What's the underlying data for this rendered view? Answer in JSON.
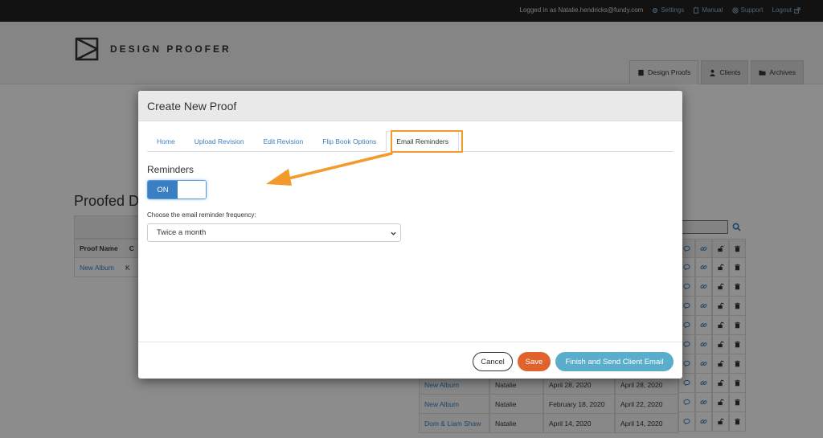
{
  "topbar": {
    "login_text": "Logged in as Natalie.hendricks@fundy.com",
    "links": [
      {
        "label": "Settings",
        "icon": "gear-icon"
      },
      {
        "label": "Manual",
        "icon": "book-icon"
      },
      {
        "label": "Support",
        "icon": "lifebuoy-icon"
      },
      {
        "label": "Logout",
        "icon": "external-link-icon"
      }
    ]
  },
  "header": {
    "logo_text": "DESIGN PROOFER",
    "nav_tabs": [
      {
        "label": "Design Proofs",
        "icon": "book-icon",
        "active": true
      },
      {
        "label": "Clients",
        "icon": "user-icon",
        "active": false
      },
      {
        "label": "Archives",
        "icon": "folder-icon",
        "active": false
      }
    ]
  },
  "background": {
    "page_title": "Proofed D",
    "left_table": {
      "header": "Proof Name",
      "header_partial": "C",
      "row_link": "New Album",
      "row_partial": "K"
    },
    "bottom_rows": [
      {
        "name": "New Album",
        "client": "Natalie",
        "date1": "April 28, 2020",
        "date2": "April 28, 2020"
      },
      {
        "name": "New Album",
        "client": "Natalie",
        "date1": "February 18, 2020",
        "date2": "April 22, 2020"
      },
      {
        "name": "Dom & Liam Shaw",
        "client": "Natalie",
        "date1": "April 14, 2020",
        "date2": "April 14, 2020"
      }
    ],
    "icon_columns": [
      "comment-icon",
      "link-icon",
      "unlock-icon",
      "trash-icon"
    ]
  },
  "modal": {
    "title": "Create New Proof",
    "tabs": [
      {
        "label": "Home",
        "active": false
      },
      {
        "label": "Upload Revision",
        "active": false
      },
      {
        "label": "Edit Revision",
        "active": false
      },
      {
        "label": "Flip Book Options",
        "active": false
      },
      {
        "label": "Email Reminders",
        "active": true
      }
    ],
    "reminders_label": "Reminders",
    "toggle_label": "ON",
    "frequency_label": "Choose the email reminder frequency:",
    "frequency_value": "Twice a month",
    "buttons": {
      "cancel": "Cancel",
      "save": "Save",
      "finish": "Finish and Send Client Email"
    }
  },
  "colors": {
    "accent_blue": "#3a7fc1",
    "save_orange": "#e0622c",
    "finish_blue": "#5aaecb",
    "highlight_orange": "#f39a2c"
  }
}
